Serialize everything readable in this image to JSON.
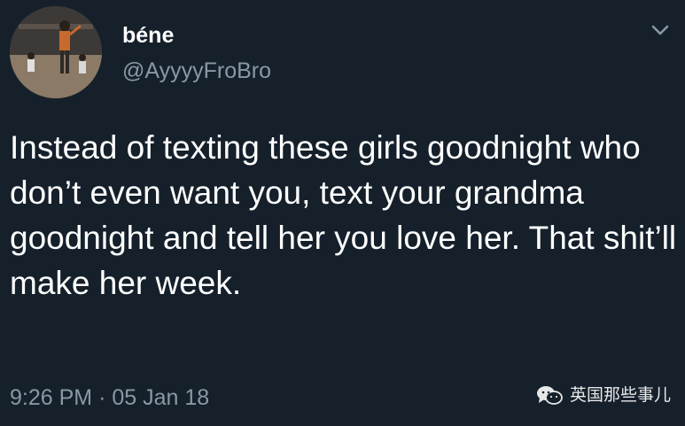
{
  "author": {
    "display_name": "béne",
    "handle": "@AyyyyFroBro"
  },
  "tweet": {
    "text": "Instead of texting these girls goodnight who don’t even want you, text your grandma goodnight and tell her you love her. That shit’ll make her week.",
    "time": "9:26 PM",
    "separator": "·",
    "date": "05 Jan 18"
  },
  "watermark": {
    "label": "英国那些事儿",
    "icon": "wechat-icon"
  },
  "icons": {
    "menu": "chevron-down-icon"
  },
  "colors": {
    "background": "#15202b",
    "primary_text": "#ffffff",
    "secondary_text": "#8899a6"
  }
}
